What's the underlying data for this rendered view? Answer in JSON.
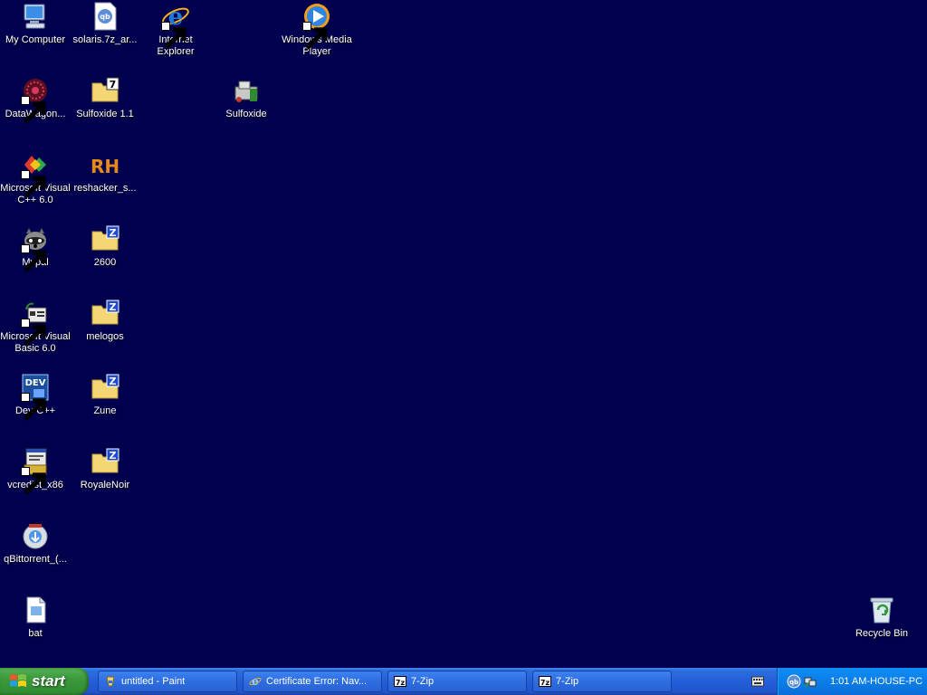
{
  "desktop": {
    "icons": {
      "my_computer": "My Computer",
      "solaris": "solaris.7z_ar...",
      "internet_explorer": "Internet Explorer",
      "windows_media_player": "Windows Media Player",
      "datawagon": "DataWagon...",
      "sulfoxide_11": "Sulfoxide 1.1",
      "sulfoxide": "Sulfoxide",
      "msvc": "Microsoft Visual C++ 6.0",
      "reshacker": "reshacker_s...",
      "mypal": "Mypal",
      "folder_2600": "2600",
      "msvb": "Microsoft Visual Basic 6.0",
      "melogos": "melogos",
      "devcpp": "Dev-C++",
      "zune": "Zune",
      "vcredist": "vcredist_x86",
      "royalenoir": "RoyaleNoir",
      "qbittorrent": "qBittorrent_(...",
      "bat": "bat",
      "recycle_bin": "Recycle Bin"
    }
  },
  "taskbar": {
    "start_label": "start",
    "tasks": [
      {
        "label": "untitled - Paint",
        "icon": "paint-icon"
      },
      {
        "label": "Certificate Error: Nav...",
        "icon": "ie-icon"
      },
      {
        "label": "7-Zip",
        "icon": "7zip-icon"
      },
      {
        "label": "7-Zip",
        "icon": "7zip-icon"
      }
    ],
    "tray": {
      "clock": "1:01 AM-HOUSE-PC"
    }
  },
  "colors": {
    "desktop_bg": "#00004f",
    "taskbar_blue": "#245edb",
    "start_green": "#3c9a3b"
  }
}
